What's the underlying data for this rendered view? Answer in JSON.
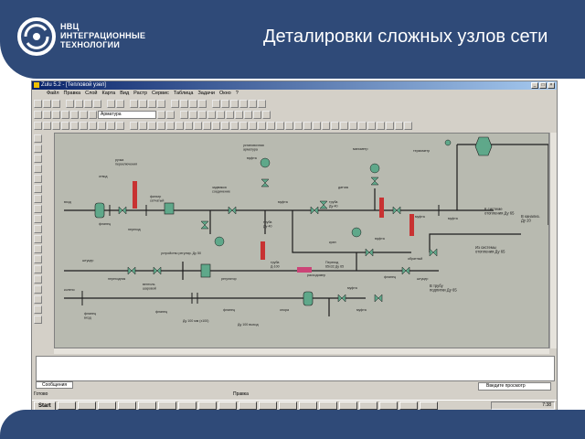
{
  "slide": {
    "title": "Деталировки сложных узлов сети",
    "logo_line1": "НВЦ",
    "logo_line2": "ИНТЕГРАЦИОННЫЕ",
    "logo_line3": "ТЕХНОЛОГИИ"
  },
  "app": {
    "window_title": "Zulu 5.2 - [Тепловой узел]",
    "menu": [
      "Файл",
      "Правка",
      "Слой",
      "Карта",
      "Вид",
      "Растр",
      "Сервис",
      "Таблица",
      "Задачи",
      "Окно",
      "?"
    ],
    "combo_value": "Арматура",
    "status_left": "Готово",
    "status_mid": "Правка",
    "status_field": "Введите просмотр",
    "message_tab": "Сообщения",
    "start_label": "Start",
    "clock": "7:38",
    "colors": {
      "pipe": "#1c1c1c",
      "valve": "#5fa88a",
      "gauge": "#c83232",
      "meter": "#cc4477",
      "canvas": "#b8bab0"
    }
  },
  "schema": {
    "labels": {
      "otvod_top_left": "отвод",
      "ruchka_top": "ручка\nпереключения",
      "zadvizhka_left": "задвижка\nсоединение",
      "flanec_1": "фланец",
      "flanec_2": "фланец",
      "flanec_3": "фланец",
      "flanec_4": "фланец",
      "perehod_1": "переход",
      "perehod_2": "переход",
      "ustanovochnaya": "установочная\nарматура",
      "mufta_1": "муфта",
      "mufta_2": "муфта",
      "mufta_3": "муфта",
      "mufta_4": "муфта",
      "mufta_5": "муфта",
      "mufta_6": "муфта",
      "mufta_7": "муфта",
      "truba_1": "труба\nДу-40",
      "truba_2": "труба\nДу-40",
      "truba_3": "труба\nД-100",
      "truba_4": "труба Ду 50",
      "ventil": "вентиль\nшаровой",
      "kran": "кран",
      "klapan": "клапан",
      "datchik": "датчик",
      "manometr": "манометр",
      "filtr": "фильтр\nсетчатый",
      "termometr": "термометр",
      "opora": "опора",
      "obratny": "обратный",
      "k_sisteme": "К системе\nотопления Ду 65",
      "iz_sistemy": "Из системы\nотопления Ду 65",
      "v_kanaliz": "В канализ.\nДу 20",
      "v_trubu": "В трубу\nподпитки Ду 65",
      "ustroistvo_1": "устройство регулир. Ду 50",
      "ustroistvo_2": "устройство регулир.",
      "shtucer_1": "штуцер",
      "shtucer_2": "штуцер",
      "perekhodnik": "переходник",
      "regulyator": "регулятор",
      "rashodomer": "расходомер",
      "perehod_dn": "Переход\n65х32 Ду 65",
      "du100": "Ду 100 мм (х100)",
      "du_vyhod": "Ду 100 выход",
      "flanets_vhod": "фланец\nвход",
      "koleno": "колено",
      "sgon": "сгон",
      "troinik": "тройник",
      "vhod": "вход"
    }
  }
}
